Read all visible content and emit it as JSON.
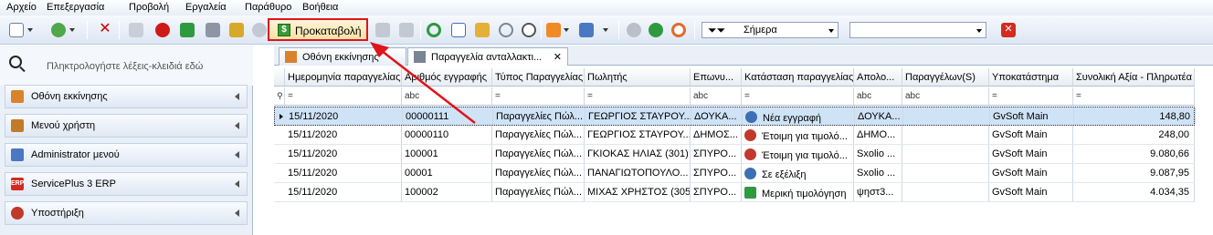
{
  "menu": [
    "Αρχείο",
    "Επεξεργασία",
    "Προβολή",
    "Εργαλεία",
    "Παράθυρο",
    "Βοήθεια"
  ],
  "toolbar": {
    "prokatavoli_label": "Προκαταβολή",
    "date_filter": "Σήμερα",
    "second_filter": ""
  },
  "sidebar": {
    "search_placeholder": "Πληκτρολογήστε λέξεις-κλειδιά εδώ",
    "items": [
      {
        "label": "Οθόνη εκκίνησης",
        "color": "#d9822b"
      },
      {
        "label": "Μενού χρήστη",
        "color": "#c27b2a"
      },
      {
        "label": "Administrator μενού",
        "color": "#4a78c2"
      },
      {
        "label": "ServicePlus 3 ERP",
        "color": "#d42a1f"
      },
      {
        "label": "Υποστήριξη",
        "color": "#c0392b"
      }
    ]
  },
  "tabs": [
    {
      "label": "Οθόνη εκκίνησης"
    },
    {
      "label": "Παραγγελία ανταλλακτι...",
      "close": "✕"
    }
  ],
  "grid": {
    "columns": [
      "Ημερομηνία παραγγελίας",
      "Αριθμός εγγραφής",
      "Τύπος Παραγγελίας",
      "Πωλητής",
      "Επωνυ...",
      "Κατάσταση παραγγελίας",
      "Απολο...",
      "Παραγγέλων(S)",
      "Υποκατάστημα",
      "Συνολική Αξία - Πληρωτέα"
    ],
    "filters": [
      "=",
      "abc",
      "=",
      "=",
      "abc",
      "=",
      "abc",
      "abc",
      "=",
      "="
    ],
    "rows": [
      [
        "15/11/2020",
        "00000111",
        "Παραγγελίες Πώλ...",
        "ΓΕΩΡΓΙΟΣ ΣΤΑΥΡΟΥ...",
        "ΔΟΥΚΑ...",
        "Νέα εγγραφή",
        "ΔΟΥΚΑ...",
        "",
        "GvSoft Main",
        "148,80"
      ],
      [
        "15/11/2020",
        "00000110",
        "Παραγγελίες Πώλ...",
        "ΓΕΩΡΓΙΟΣ ΣΤΑΥΡΟΥ...",
        "ΔΗΜΟΣ...",
        "Έτοιμη για τιμολό...",
        "ΔΗΜΟ...",
        "",
        "GvSoft Main",
        "248,00"
      ],
      [
        "15/11/2020",
        "100001",
        "Παραγγελίες Πώλ...",
        "ΓΚΙΟΚΑΣ ΗΛΙΑΣ  (301)",
        "ΣΠΥΡΟ...",
        "Έτοιμη για τιμολό...",
        "Sxolio ...",
        "",
        "GvSoft Main",
        "9.080,66"
      ],
      [
        "15/11/2020",
        "00001",
        "Παραγγελίες Πώλ...",
        "ΠΑΝΑΓΙΩΤΟΠΟΥΛΟ...",
        "ΣΠΥΡΟ...",
        "Σε εξέλιξη",
        "Sxolio ...",
        "",
        "GvSoft Main",
        "9.087,95"
      ],
      [
        "15/11/2020",
        "100002",
        "Παραγγελίες Πώλ...",
        "ΜΙΧΑΣ ΧΡΗΣΤΟΣ (305)",
        "ΣΠΥΡΟ...",
        "Μερική τιμολόγηση",
        "ψηστ3...",
        "",
        "GvSoft Main",
        "4.034,35"
      ]
    ],
    "status_icons": [
      "clock-icon",
      "hourglass-icon",
      "hourglass-icon",
      "pie-clock-icon",
      "money-icon"
    ]
  }
}
